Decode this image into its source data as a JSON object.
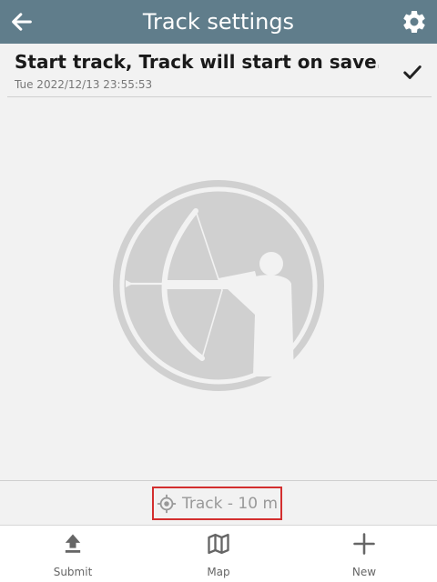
{
  "header": {
    "title": "Track settings",
    "icons": {
      "back": "arrow-left-icon",
      "settings": "gear-icon"
    }
  },
  "track": {
    "title": "Start track, Track will start on save...",
    "date": "Tue 2022/12/13 23:55:53",
    "confirm_icon": "checkmark-icon"
  },
  "logo": {
    "icon": "archer-logo-icon"
  },
  "status": {
    "label": "Track - 10 m",
    "icon": "gps-target-icon"
  },
  "bottom_nav": {
    "items": [
      {
        "label": "Submit",
        "icon": "upload-icon"
      },
      {
        "label": "Map",
        "icon": "map-icon"
      },
      {
        "label": "New",
        "icon": "plus-icon"
      }
    ]
  },
  "colors": {
    "app_bar": "#607d8b",
    "status_highlight": "#d32f2f",
    "logo_gray": "#d0d0d0"
  }
}
